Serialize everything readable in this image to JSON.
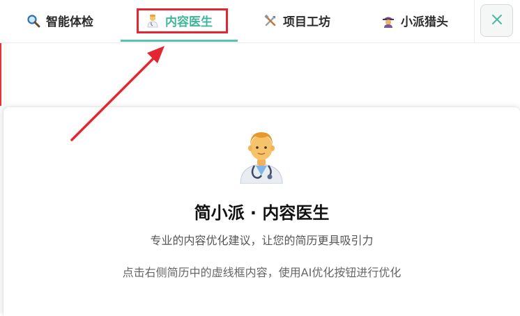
{
  "tabs": [
    {
      "label": "智能体检",
      "icon": "magnifier-icon"
    },
    {
      "label": "内容医生",
      "icon": "doctor-icon",
      "active": true
    },
    {
      "label": "项目工坊",
      "icon": "tools-icon"
    },
    {
      "label": "小派猎头",
      "icon": "detective-icon"
    }
  ],
  "close_icon": "close-icon",
  "panel": {
    "title": "简小派 · 内容医生",
    "subtitle": "专业的内容优化建议，让您的简历更具吸引力",
    "hint": "点击右侧简历中的虚线框内容，使用AI优化按钮进行优化"
  },
  "colors": {
    "accent": "#3fb59a",
    "highlight": "#e3262f",
    "annotation_arrow": "#e3262f"
  }
}
